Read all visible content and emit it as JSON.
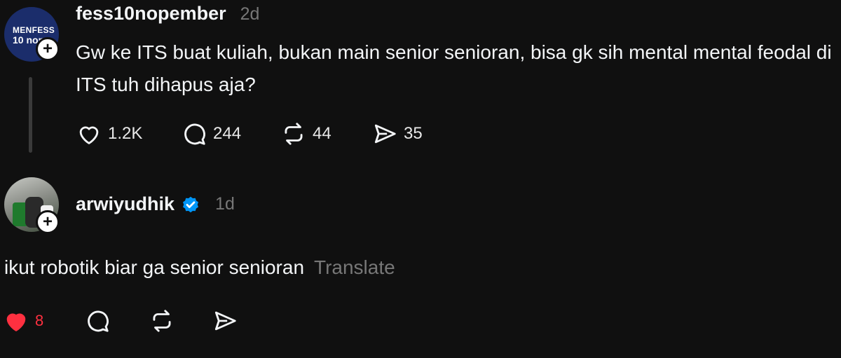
{
  "post1": {
    "avatar": {
      "brand_line1": "MENFESS",
      "brand_line2": "10 nop",
      "bg_color": "#1b2d6b"
    },
    "username": "fess10nopember",
    "time": "2d",
    "text": "Gw ke ITS buat kuliah, bukan main senior senioran, bisa gk sih mental mental feodal di ITS tuh dihapus aja?",
    "actions": {
      "like_icon": "heart-outline-icon",
      "like_count": "1.2K",
      "reply_icon": "comment-icon",
      "reply_count": "244",
      "repost_icon": "repost-icon",
      "repost_count": "44",
      "share_icon": "share-icon",
      "share_count": "35"
    }
  },
  "post2": {
    "username": "arwiyudhik",
    "verified": true,
    "verified_color": "#0095f6",
    "time": "1d",
    "text": "ikut robotik biar ga senior senioran",
    "translate_label": "Translate",
    "actions": {
      "like_icon": "heart-filled-icon",
      "like_count": "8",
      "like_color": "#ff3040",
      "reply_icon": "comment-icon",
      "repost_icon": "repost-icon",
      "share_icon": "share-icon"
    }
  },
  "colors": {
    "background": "#101010",
    "text": "#f3f5f7",
    "muted": "#777777",
    "thread_line": "#3a3a3a"
  }
}
